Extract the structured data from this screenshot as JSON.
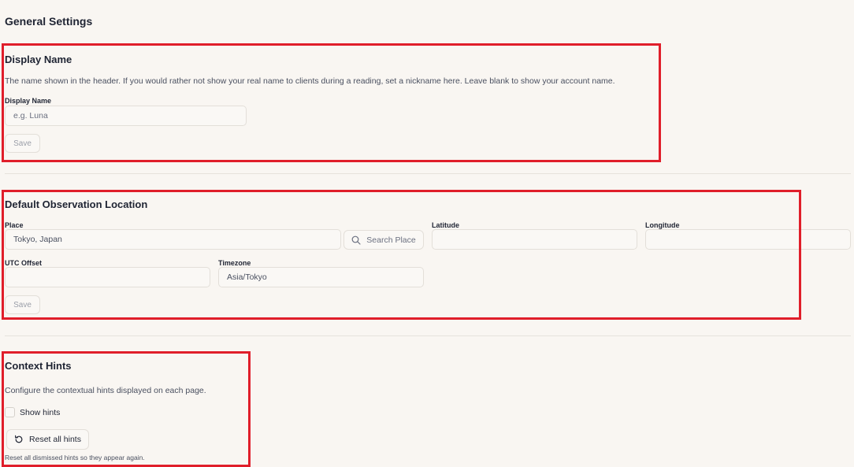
{
  "page": {
    "title": "General Settings"
  },
  "display_name": {
    "title": "Display Name",
    "description": "The name shown in the header. If you would rather not show your real name to clients during a reading, set a nickname here. Leave blank to show your account name.",
    "field_label": "Display Name",
    "field_value": "",
    "field_placeholder": "e.g. Luna",
    "save_label": "Save"
  },
  "location": {
    "title": "Default Observation Location",
    "place_label": "Place",
    "place_value": "Tokyo, Japan",
    "search_label": "Search Place",
    "latitude_label": "Latitude",
    "latitude_value": "",
    "longitude_label": "Longitude",
    "longitude_value": "",
    "utc_label": "UTC Offset",
    "utc_value": "",
    "timezone_label": "Timezone",
    "timezone_value": "Asia/Tokyo",
    "save_label": "Save"
  },
  "hints": {
    "title": "Context Hints",
    "description": "Configure the contextual hints displayed on each page.",
    "show_hints_label": "Show hints",
    "show_hints_checked": false,
    "reset_label": "Reset all hints",
    "reset_note": "Reset all dismissed hints so they appear again."
  },
  "colors": {
    "highlight": "#e01e2a",
    "background": "#f9f6f2",
    "text": "#1f2433"
  }
}
